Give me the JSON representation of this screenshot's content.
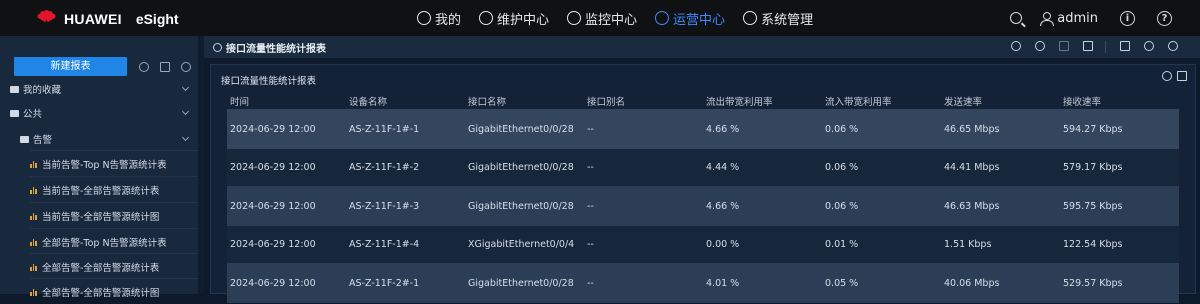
{
  "header": {
    "brand": "HUAWEI",
    "product": "eSight",
    "nav": [
      {
        "label": "我的",
        "icon": "user-icon"
      },
      {
        "label": "维护中心",
        "icon": "maintenance-icon"
      },
      {
        "label": "监控中心",
        "icon": "eye-icon"
      },
      {
        "label": "运营中心",
        "icon": "operations-icon",
        "active": true
      },
      {
        "label": "系统管理",
        "icon": "gear-icon"
      }
    ],
    "user": "admin",
    "right_icons": [
      "search-icon",
      "user-icon",
      "info-icon",
      "help-icon"
    ]
  },
  "sidebar": {
    "new_report_label": "新建报表",
    "tree": [
      {
        "label": "我的收藏",
        "icon": "folder-icon",
        "level": 0
      },
      {
        "label": "公共",
        "icon": "folder-icon",
        "level": 0
      },
      {
        "label": "告警",
        "icon": "folder-icon",
        "level": 1
      },
      {
        "label": "当前告警-Top N告警源统计表",
        "icon": "chart-icon",
        "level": 2
      },
      {
        "label": "当前告警-全部告警源统计表",
        "icon": "chart-icon",
        "level": 2
      },
      {
        "label": "当前告警-全部告警源统计图",
        "icon": "chart-icon",
        "level": 2
      },
      {
        "label": "全部告警-Top N告警源统计表",
        "icon": "chart-icon",
        "level": 2
      },
      {
        "label": "全部告警-全部告警源统计表",
        "icon": "chart-icon",
        "level": 2
      },
      {
        "label": "全部告警-全部告警源统计图",
        "icon": "chart-icon",
        "level": 2
      }
    ]
  },
  "main": {
    "title": "接口流量性能统计报表",
    "panel_title": "接口流量性能统计报表",
    "columns": [
      "时间",
      "设备名称",
      "接口名称",
      "接口别名",
      "流出带宽利用率",
      "流入带宽利用率",
      "发送速率",
      "接收速率"
    ],
    "rows": [
      [
        "2024-06-29 12:00",
        "AS-Z-11F-1#-1",
        "GigabitEthernet0/0/28",
        "--",
        "4.66 %",
        "0.06 %",
        "46.65 Mbps",
        "594.27 Kbps"
      ],
      [
        "2024-06-29 12:00",
        "AS-Z-11F-1#-2",
        "GigabitEthernet0/0/28",
        "--",
        "4.44 %",
        "0.06 %",
        "44.41 Mbps",
        "579.17 Kbps"
      ],
      [
        "2024-06-29 12:00",
        "AS-Z-11F-1#-3",
        "GigabitEthernet0/0/28",
        "--",
        "4.66 %",
        "0.06 %",
        "46.63 Mbps",
        "595.75 Kbps"
      ],
      [
        "2024-06-29 12:00",
        "AS-Z-11F-1#-4",
        "XGigabitEthernet0/0/4",
        "--",
        "0.00 %",
        "0.01 %",
        "1.51 Kbps",
        "122.54 Kbps"
      ],
      [
        "2024-06-29 12:00",
        "AS-Z-11F-2#-1",
        "GigabitEthernet0/0/28",
        "--",
        "4.01 %",
        "0.05 %",
        "40.06 Mbps",
        "529.57 Kbps"
      ]
    ]
  }
}
